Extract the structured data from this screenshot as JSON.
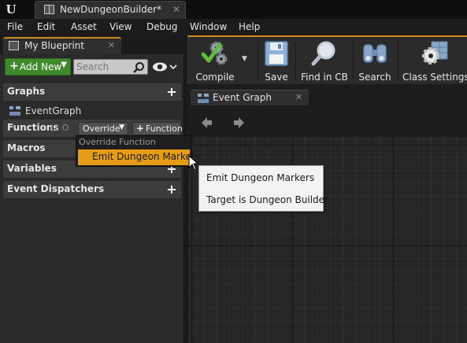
{
  "titlebar": {
    "doc_tab_label": "NewDungeonBuilder*",
    "doc_tab_close": "✕"
  },
  "menu": [
    "File",
    "Edit",
    "Asset",
    "View",
    "Debug",
    "Window",
    "Help"
  ],
  "left_panel": {
    "tab_label": "My Blueprint",
    "tab_close": "✕",
    "add_new_label": "Add New",
    "search_placeholder": "Search",
    "sections": {
      "graphs": "Graphs",
      "graph_item": "EventGraph",
      "functions": "Functions",
      "functions_count": "(1 O",
      "override_label": "Override",
      "function_label": "Function",
      "macros": "Macros",
      "variables": "Variables",
      "event_dispatchers": "Event Dispatchers"
    }
  },
  "override_dropdown": {
    "header": "Override Function",
    "item": "Emit Dungeon Markers"
  },
  "tooltip": {
    "line1": "Emit Dungeon Markers",
    "line2": "Target is Dungeon Builder"
  },
  "toolbar": {
    "compile": "Compile",
    "save": "Save",
    "find_in_cb": "Find in CB",
    "search": "Search",
    "class_settings": "Class Settings"
  },
  "graph": {
    "tab_label": "Event Graph",
    "tab_close": "✕"
  },
  "colors": {
    "accent_orange": "#e59d16",
    "add_new_green": "#3f8b2c",
    "compile_check_green": "#5fbf3a"
  },
  "icons": {
    "app_logo": "unreal-logo-icon",
    "blueprint_tab": "blueprint-book-icon",
    "graph_item": "event-graph-icon",
    "search": "magnifier-icon",
    "visibility": "eye-icon",
    "compile": "gears-check-icon",
    "save": "floppy-disk-icon",
    "find_in_cb": "magnifier-icon",
    "search_tool": "binoculars-icon",
    "class_settings": "gear-grid-icon",
    "nav_back": "arrow-left-icon",
    "nav_forward": "arrow-right-icon"
  }
}
